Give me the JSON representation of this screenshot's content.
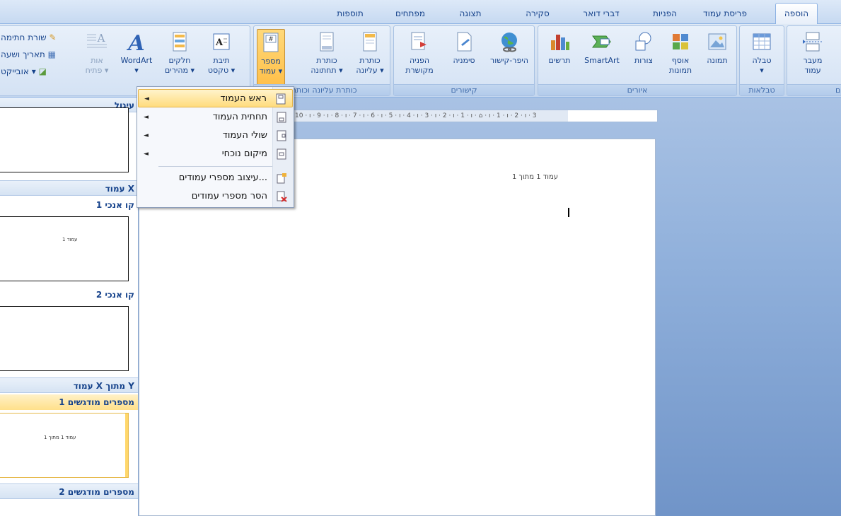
{
  "tabs": [
    {
      "label": "הוספה",
      "active": true
    },
    {
      "label": "פריסת עמוד",
      "active": false
    },
    {
      "label": "הפניות",
      "active": false
    },
    {
      "label": "דברי דואר",
      "active": false
    },
    {
      "label": "סקירה",
      "active": false
    },
    {
      "label": "תצוגה",
      "active": false
    },
    {
      "label": "מפתחים",
      "active": false
    },
    {
      "label": "תוספות",
      "active": false
    }
  ],
  "ribbon": {
    "pages_group": {
      "break_label_1": "מעבר",
      "break_label_2": "עמוד"
    },
    "tables_group": {
      "label": "טבלאות",
      "table_label": "טבלה",
      "table_arrow": "▾"
    },
    "illustrations_group": {
      "label": "איורים",
      "picture": "תמונה",
      "clipart_1": "אוסף",
      "clipart_2": "תמונות",
      "shapes": "צורות",
      "smartart": "SmartArt",
      "chart": "תרשים"
    },
    "links_group": {
      "label": "קישורים",
      "hyperlink": "היפר-קישור",
      "bookmark": "סימניה",
      "crossref_1": "הפניה",
      "crossref_2": "מקושרת"
    },
    "header_footer_group": {
      "label": "כותרת עליונה וכותרת",
      "header_1": "כותרת",
      "header_2": "עליונה ▾",
      "footer_1": "כותרת",
      "footer_2": "תחתונה ▾",
      "pagenum_1": "מספר",
      "pagenum_2": "עמוד ▾"
    },
    "text_group": {
      "textbox_1": "תיבת",
      "textbox_2": "טקסט ▾",
      "quickparts_1": "חלקים",
      "quickparts_2": "מהירים ▾",
      "wordart_1": "WordArt",
      "wordart_2": "▾",
      "dropcap_1": "אות",
      "dropcap_2": "פתיח ▾",
      "sigline": "שורת חתימה",
      "datetime": "תאריך ושעה",
      "object": "אובייקט ▾"
    }
  },
  "menu": {
    "items": [
      {
        "label": "ראש העמוד",
        "arrow": "◄"
      },
      {
        "label": "תחתית העמוד",
        "arrow": "◄"
      },
      {
        "label": "שולי העמוד",
        "arrow": "◄"
      },
      {
        "label": "מיקום נוכחי",
        "arrow": "◄"
      },
      {
        "label": "עיצוב מספרי עמודים...",
        "arrow": ""
      },
      {
        "label": "הסר מספרי עמודים",
        "arrow": ""
      }
    ]
  },
  "gallery": {
    "sections": [
      {
        "head": "עיגול"
      },
      {
        "head": "עמוד X"
      },
      {
        "head": "עמוד X מתוך Y"
      },
      {
        "head": "מספרים מודגשים 2"
      }
    ],
    "subs": [
      "קו אנכי 1",
      "קו אנכי 2",
      "מספרים מודגשים 1"
    ],
    "thumb_text_1": "עמוד 1",
    "thumb_text_2": "עמוד 1 מתוך 1"
  },
  "ruler": {
    "text": "10 · ı · 9 · ı · 8 · ı · 7 · ı · 6 · ı · 5 · ı · 4 · ı · 3 · ı · 2 · ı · 1 · ı · ⌂ · ı · 1 · ı · 2 · ı · 3"
  },
  "document": {
    "header_text": "עמוד 1 מתוך 1"
  }
}
